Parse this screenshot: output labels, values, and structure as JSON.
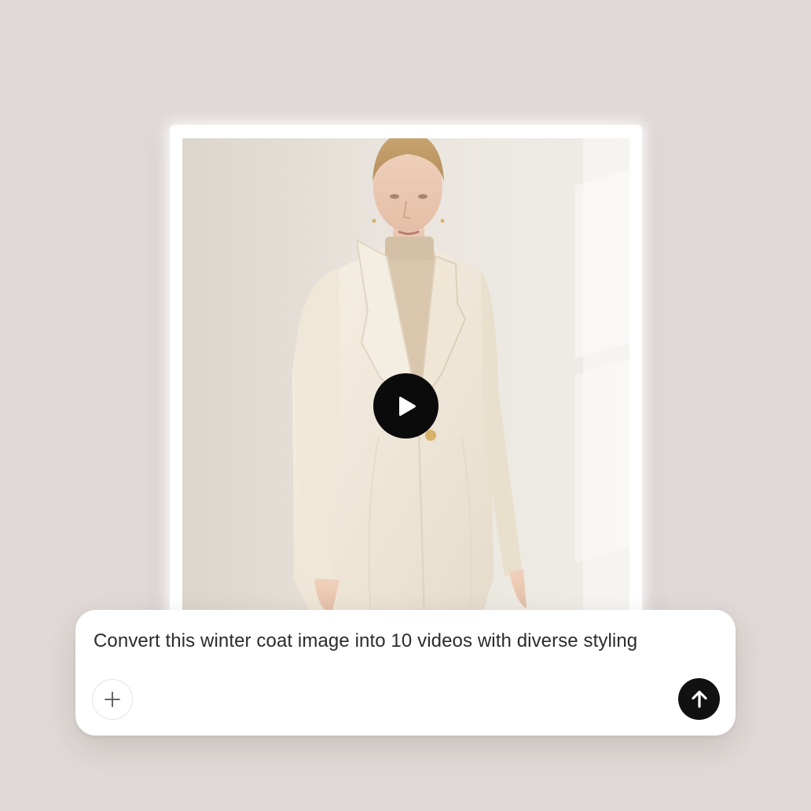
{
  "media": {
    "image_alt": "Model wearing a cream winter coat over a beige turtleneck",
    "play_icon": "play-icon"
  },
  "prompt": {
    "text": "Convert this winter coat image into 10 videos with diverse styling",
    "add_icon": "plus-icon",
    "send_icon": "arrow-up-icon"
  },
  "colors": {
    "background": "#e0d9d7",
    "card": "#ffffff",
    "button_dark": "#111111",
    "coat": "#f1eadd",
    "turtleneck": "#d9c6ad"
  }
}
